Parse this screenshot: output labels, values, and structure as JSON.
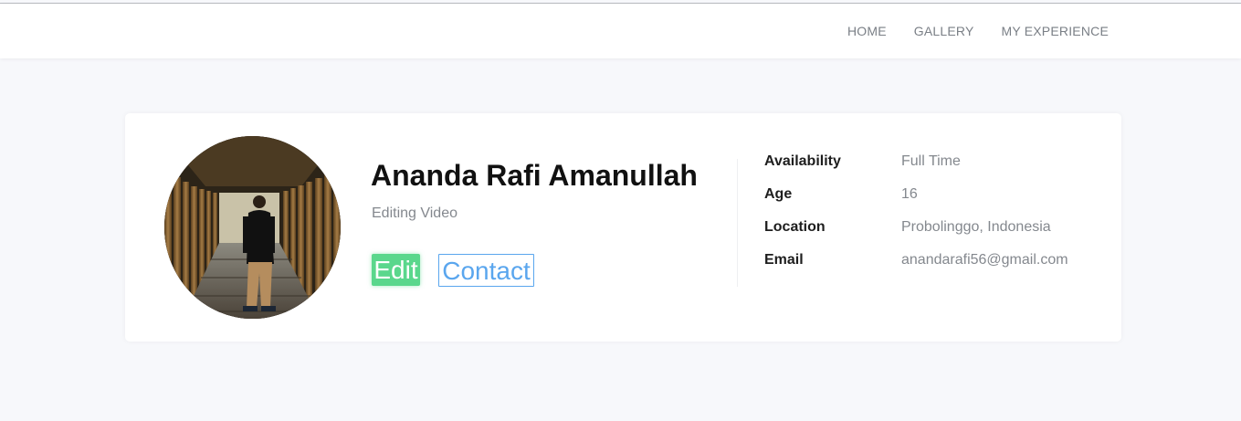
{
  "nav": {
    "items": [
      {
        "label": "HOME"
      },
      {
        "label": "GALLERY"
      },
      {
        "label": "MY EXPERIENCE"
      }
    ]
  },
  "profile": {
    "name": "Ananda Rafi Amanullah",
    "role": "Editing Video",
    "edit_label": "Edit",
    "contact_label": "Contact",
    "avatar_description_icon": "profile-photo"
  },
  "info": {
    "rows": [
      {
        "key": "Availability",
        "value": "Full Time"
      },
      {
        "key": "Age",
        "value": "16"
      },
      {
        "key": "Location",
        "value": "Probolinggo, Indonesia"
      },
      {
        "key": "Email",
        "value": "anandarafi56@gmail.com"
      }
    ]
  },
  "colors": {
    "edit_button": "#5ad78c",
    "contact_button": "#5aa6ee",
    "page_background": "#f7f8fb"
  }
}
